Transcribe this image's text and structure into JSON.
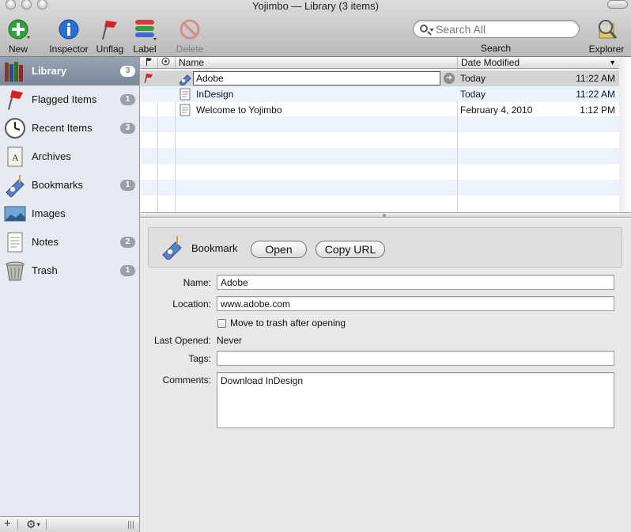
{
  "window": {
    "title": "Yojimbo — Library (3 items)"
  },
  "toolbar": {
    "new_label": "New",
    "inspector_label": "Inspector",
    "unflag_label": "Unflag",
    "label_label": "Label",
    "delete_label": "Delete",
    "search_placeholder": "Search All",
    "search_label": "Search",
    "explorer_label": "Explorer"
  },
  "sidebar": {
    "items": [
      {
        "label": "Library",
        "count": "3",
        "icon": "library-icon"
      },
      {
        "label": "Flagged Items",
        "count": "1",
        "icon": "flag-icon"
      },
      {
        "label": "Recent Items",
        "count": "3",
        "icon": "clock-icon"
      },
      {
        "label": "Archives",
        "count": "",
        "icon": "archive-icon"
      },
      {
        "label": "Bookmarks",
        "count": "1",
        "icon": "bookmark-icon"
      },
      {
        "label": "Images",
        "count": "",
        "icon": "image-icon"
      },
      {
        "label": "Notes",
        "count": "2",
        "icon": "note-icon"
      },
      {
        "label": "Trash",
        "count": "1",
        "icon": "trash-icon"
      }
    ]
  },
  "list": {
    "columns": {
      "name": "Name",
      "date_modified": "Date Modified"
    },
    "rows": [
      {
        "name": "Adobe",
        "date": "Today",
        "time": "11:22 AM",
        "flagged": true,
        "type": "bookmark"
      },
      {
        "name": "InDesign",
        "date": "Today",
        "time": "11:22 AM",
        "flagged": false,
        "type": "note"
      },
      {
        "name": "Welcome to Yojimbo",
        "date": "February 4, 2010",
        "time": "1:12 PM",
        "flagged": false,
        "type": "note"
      }
    ]
  },
  "detail": {
    "kind": "Bookmark",
    "open_label": "Open",
    "copy_url_label": "Copy URL",
    "name_label": "Name:",
    "name_value": "Adobe",
    "location_label": "Location:",
    "location_value": "www.adobe.com",
    "trash_checkbox_label": "Move to trash after opening",
    "trash_checked": false,
    "last_opened_label": "Last Opened:",
    "last_opened_value": "Never",
    "tags_label": "Tags:",
    "tags_value": "",
    "comments_label": "Comments:",
    "comments_value": "Download InDesign"
  },
  "colors": {
    "sidebar_bg": "#e6eaf0",
    "selection": "#7b8699",
    "row_alt": "#edf3fe"
  }
}
